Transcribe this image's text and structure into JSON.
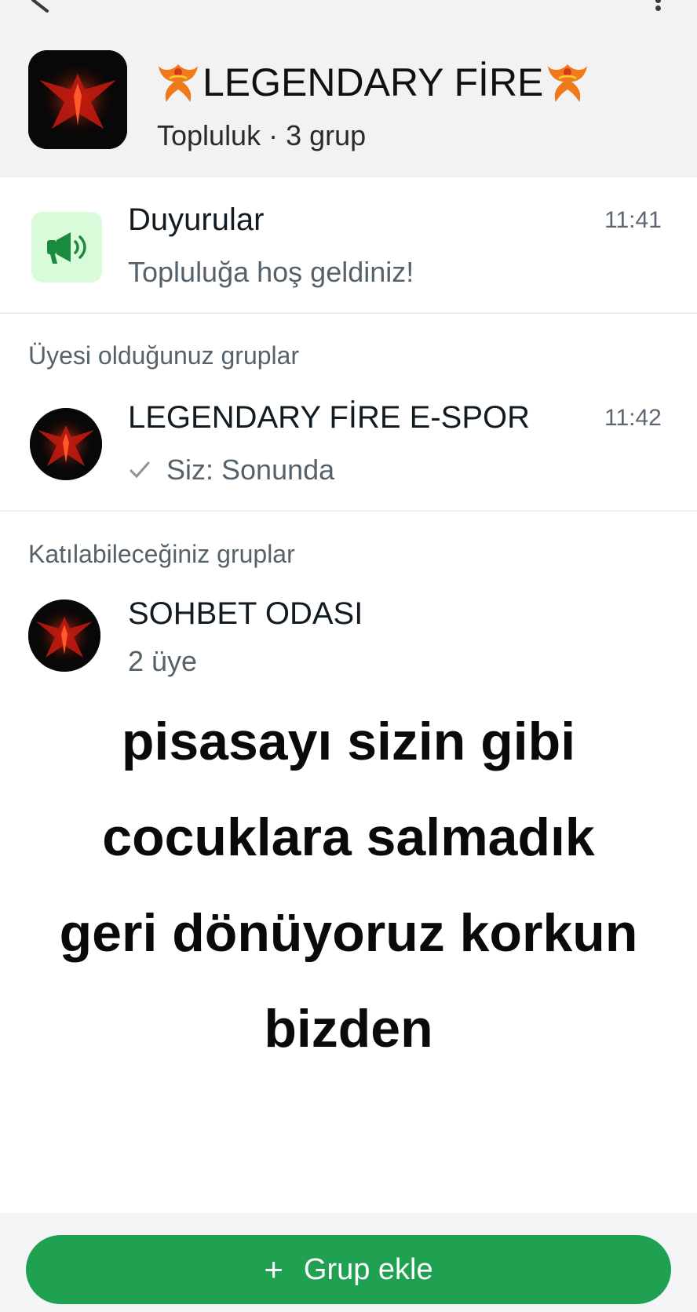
{
  "community": {
    "name": "LEGENDARY FİRE",
    "subtitle": "Topluluk · 3 grup"
  },
  "announcements": {
    "title": "Duyurular",
    "message": "Topluluğa hoş geldiniz!",
    "time": "11:41"
  },
  "member_groups": {
    "label": "Üyesi olduğunuz gruplar",
    "items": [
      {
        "name": "LEGENDARY FİRE E-SPOR",
        "last_message": "Siz: Sonunda",
        "time": "11:42"
      }
    ]
  },
  "joinable_groups": {
    "label": "Katılabileceğiniz gruplar",
    "items": [
      {
        "name": "SOHBET ODASI",
        "members": "2 üye"
      }
    ]
  },
  "overlay_text": {
    "line1": "pisasayı sizin gibi",
    "line2": "cocuklara salmadık",
    "line3": "geri dönüyoruz korkun",
    "line4": "bizden"
  },
  "add_group_button": {
    "icon": "+",
    "label": "Grup ekle"
  },
  "colors": {
    "accent": "#20a152",
    "announcement_bg": "#d9fbd9"
  }
}
